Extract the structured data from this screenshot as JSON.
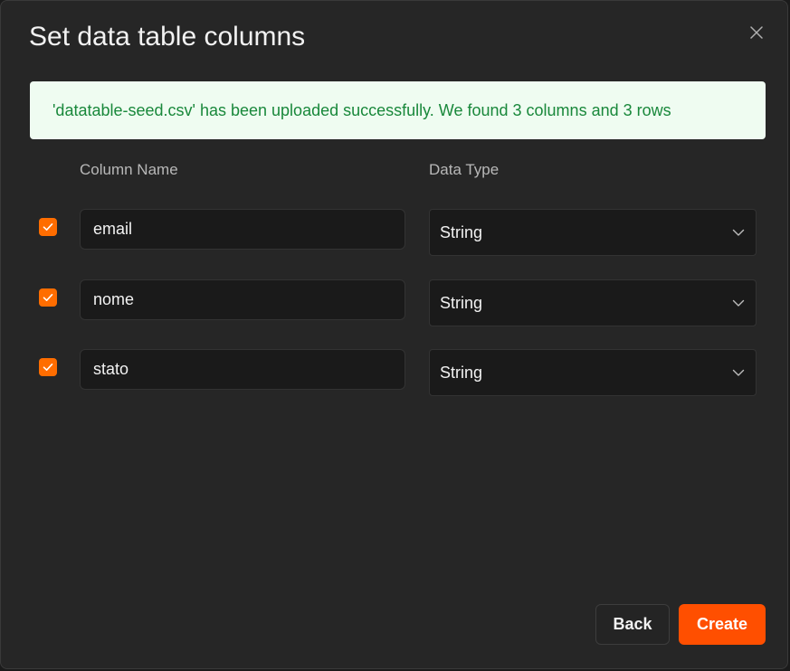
{
  "dialog": {
    "title": "Set data table columns",
    "close_icon": "close-icon"
  },
  "banner": {
    "message": "'datatable-seed.csv' has been uploaded successfully. We found 3 columns and 3 rows",
    "bg_color": "#effcf1",
    "text_color": "#19883b"
  },
  "table": {
    "headers": {
      "column_name": "Column Name",
      "data_type": "Data Type"
    },
    "rows": [
      {
        "checked": true,
        "name": "email",
        "type": "String"
      },
      {
        "checked": true,
        "name": "nome",
        "type": "String"
      },
      {
        "checked": true,
        "name": "stato",
        "type": "String"
      }
    ]
  },
  "actions": {
    "back_label": "Back",
    "create_label": "Create"
  },
  "colors": {
    "accent": "#ff6d00",
    "primary_button": "#ff4f00",
    "background": "#262626"
  }
}
